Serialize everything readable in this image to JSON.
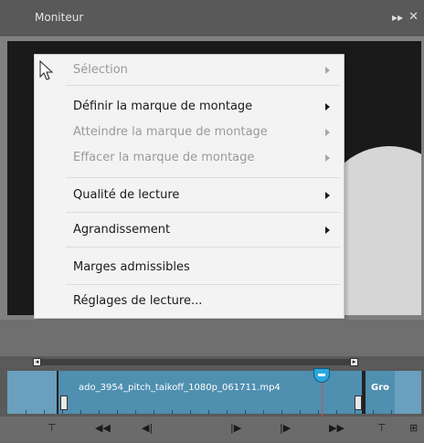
{
  "panel": {
    "title": "Moniteur"
  },
  "menu": {
    "items": [
      {
        "label": "Sélection",
        "disabled": true,
        "submenu": true
      },
      {
        "label": "Définir la marque de montage",
        "disabled": false,
        "submenu": true
      },
      {
        "label": "Atteindre la marque de montage",
        "disabled": true,
        "submenu": true
      },
      {
        "label": "Effacer la marque de montage",
        "disabled": true,
        "submenu": true
      },
      {
        "label": "Qualité de lecture",
        "disabled": false,
        "submenu": true
      },
      {
        "label": "Agrandissement",
        "disabled": false,
        "submenu": true
      },
      {
        "label": "Marges admissibles",
        "disabled": false,
        "submenu": false
      },
      {
        "label": "Réglages de lecture...",
        "disabled": false,
        "submenu": false
      }
    ]
  },
  "timeline": {
    "clip1": "ado_3954_pitch_taikoff_1080p_061711.mp4",
    "clip2": "Gro"
  },
  "icons": {
    "panel": [
      "expand-icon",
      "close-icon"
    ],
    "controls": [
      "set-in-icon",
      "rewind-icon",
      "step-back-icon",
      "step-forward-icon",
      "play-icon",
      "fast-forward-icon",
      "set-out-icon",
      "more-icon"
    ]
  }
}
